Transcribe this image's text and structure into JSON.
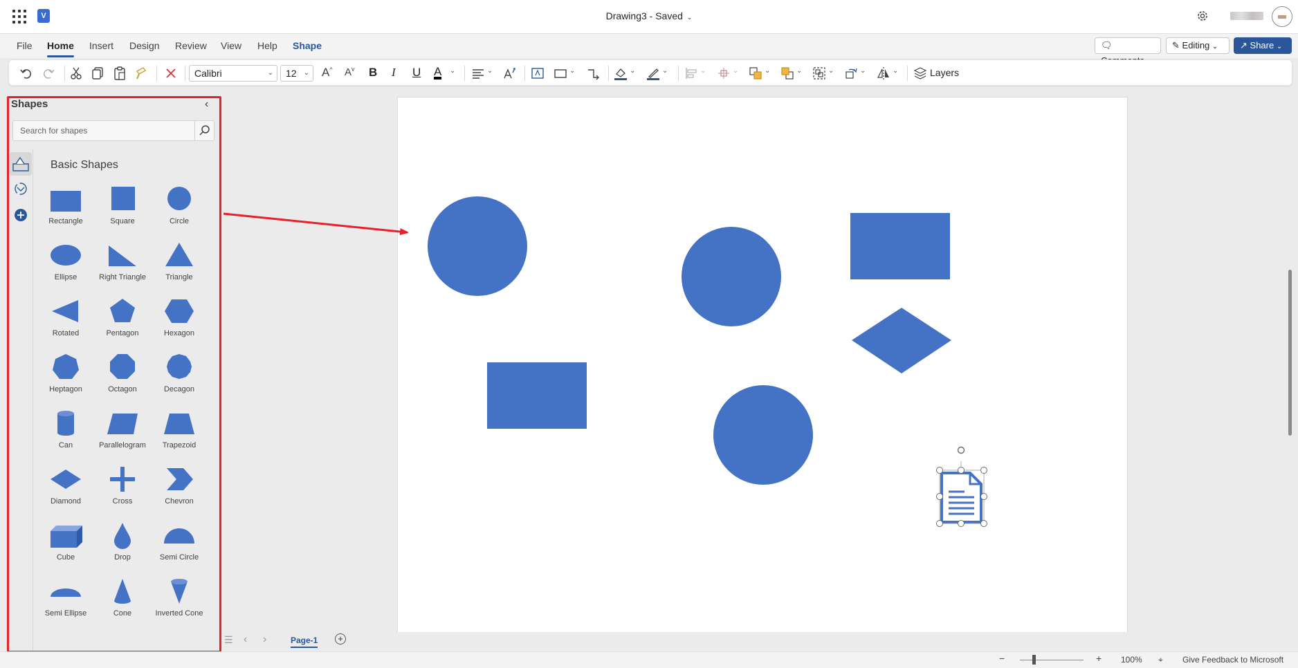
{
  "app": {
    "doc_title": "Drawing3",
    "save_status": "Saved",
    "brand_color": "#2b579a",
    "shape_fill": "#4472c4"
  },
  "ribbon": {
    "tabs": [
      {
        "label": "File"
      },
      {
        "label": "Home"
      },
      {
        "label": "Insert"
      },
      {
        "label": "Design"
      },
      {
        "label": "Review"
      },
      {
        "label": "View"
      },
      {
        "label": "Help"
      },
      {
        "label": "Shape"
      }
    ],
    "active_tab": "Home",
    "comments_label": "Comments",
    "editing_label": "Editing",
    "share_label": "Share"
  },
  "toolbar": {
    "font_name": "Calibri",
    "font_size": "12",
    "layers_label": "Layers"
  },
  "shapes_panel": {
    "title": "Shapes",
    "search_placeholder": "Search for shapes",
    "stencil_title": "Basic Shapes",
    "shapes": [
      {
        "label": "Rectangle",
        "icon": "rectangle"
      },
      {
        "label": "Square",
        "icon": "square"
      },
      {
        "label": "Circle",
        "icon": "circle"
      },
      {
        "label": "Ellipse",
        "icon": "ellipse"
      },
      {
        "label": "Right Triangle",
        "icon": "right-triangle"
      },
      {
        "label": "Triangle",
        "icon": "triangle"
      },
      {
        "label": "Rotated",
        "icon": "rotated-triangle"
      },
      {
        "label": "Pentagon",
        "icon": "pentagon"
      },
      {
        "label": "Hexagon",
        "icon": "hexagon"
      },
      {
        "label": "Heptagon",
        "icon": "heptagon"
      },
      {
        "label": "Octagon",
        "icon": "octagon"
      },
      {
        "label": "Decagon",
        "icon": "decagon"
      },
      {
        "label": "Can",
        "icon": "can"
      },
      {
        "label": "Parallelogram",
        "icon": "parallelogram"
      },
      {
        "label": "Trapezoid",
        "icon": "trapezoid"
      },
      {
        "label": "Diamond",
        "icon": "diamond"
      },
      {
        "label": "Cross",
        "icon": "cross"
      },
      {
        "label": "Chevron",
        "icon": "chevron"
      },
      {
        "label": "Cube",
        "icon": "cube"
      },
      {
        "label": "Drop",
        "icon": "drop"
      },
      {
        "label": "Semi Circle",
        "icon": "semi-circle"
      },
      {
        "label": "Semi Ellipse",
        "icon": "semi-ellipse"
      },
      {
        "label": "Cone",
        "icon": "cone"
      },
      {
        "label": "Inverted Cone",
        "icon": "inverted-cone"
      }
    ]
  },
  "canvas": {
    "shapes": [
      "circle",
      "circle",
      "rectangle",
      "diamond",
      "rectangle",
      "circle",
      "document"
    ],
    "selected_shape": "document"
  },
  "pages": {
    "current_page": "Page-1"
  },
  "status": {
    "zoom": "100%",
    "feedback_label": "Give Feedback to Microsoft"
  }
}
